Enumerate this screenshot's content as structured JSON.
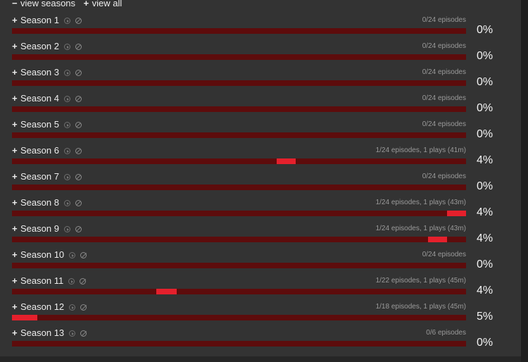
{
  "header": {
    "view_seasons": "view seasons",
    "view_all": "view all",
    "minus_sign": "−",
    "plus_sign": "+"
  },
  "colors": {
    "bar_track": "#5d0c0c",
    "bar_fill": "#e5202c",
    "background": "#333333"
  },
  "seasons": [
    {
      "name": "Season 1",
      "stats": "0/24 episodes",
      "percent": "0%",
      "fill_start": null,
      "fill_fraction": 0
    },
    {
      "name": "Season 2",
      "stats": "0/24 episodes",
      "percent": "0%",
      "fill_start": null,
      "fill_fraction": 0
    },
    {
      "name": "Season 3",
      "stats": "0/24 episodes",
      "percent": "0%",
      "fill_start": null,
      "fill_fraction": 0
    },
    {
      "name": "Season 4",
      "stats": "0/24 episodes",
      "percent": "0%",
      "fill_start": null,
      "fill_fraction": 0
    },
    {
      "name": "Season 5",
      "stats": "0/24 episodes",
      "percent": "0%",
      "fill_start": null,
      "fill_fraction": 0
    },
    {
      "name": "Season 6",
      "stats": "1/24 episodes, 1 plays (41m)",
      "percent": "4%",
      "fill_start": 0.583,
      "fill_fraction": 0.042
    },
    {
      "name": "Season 7",
      "stats": "0/24 episodes",
      "percent": "0%",
      "fill_start": null,
      "fill_fraction": 0
    },
    {
      "name": "Season 8",
      "stats": "1/24 episodes, 1 plays (43m)",
      "percent": "4%",
      "fill_start": 0.958,
      "fill_fraction": 0.042
    },
    {
      "name": "Season 9",
      "stats": "1/24 episodes, 1 plays (43m)",
      "percent": "4%",
      "fill_start": 0.917,
      "fill_fraction": 0.042
    },
    {
      "name": "Season 10",
      "stats": "0/24 episodes",
      "percent": "0%",
      "fill_start": null,
      "fill_fraction": 0
    },
    {
      "name": "Season 11",
      "stats": "1/22 episodes, 1 plays (45m)",
      "percent": "4%",
      "fill_start": 0.318,
      "fill_fraction": 0.045
    },
    {
      "name": "Season 12",
      "stats": "1/18 episodes, 1 plays (45m)",
      "percent": "5%",
      "fill_start": 0.0,
      "fill_fraction": 0.056
    },
    {
      "name": "Season 13",
      "stats": "0/6 episodes",
      "percent": "0%",
      "fill_start": null,
      "fill_fraction": 0
    }
  ]
}
